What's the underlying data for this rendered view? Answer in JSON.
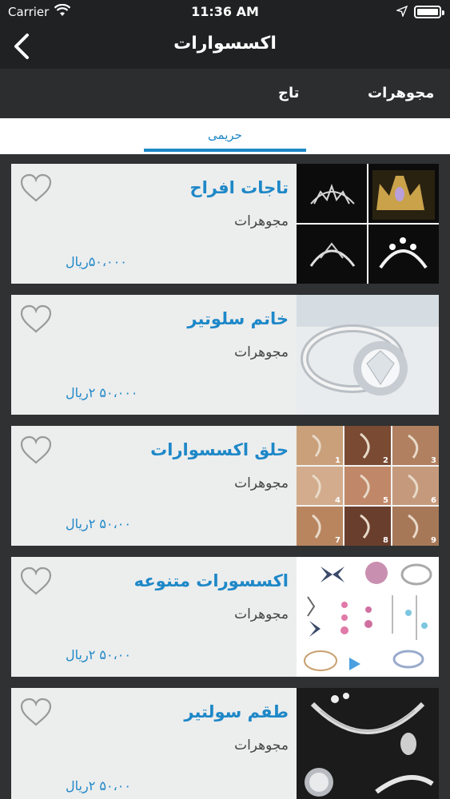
{
  "status": {
    "carrier": "Carrier",
    "time": "11:36 AM"
  },
  "nav": {
    "title": "اکسسوارات"
  },
  "categories": [
    "مجوهرات",
    "تاج"
  ],
  "subtab": {
    "label": "حریمی"
  },
  "colors": {
    "accent": "#1e88c8",
    "nav_bg": "#1f2122",
    "card_bg": "#eceded"
  },
  "products": [
    {
      "name": "تاجات افراح",
      "category": "مجوهرات",
      "price": "۵۰،۰۰۰ریال",
      "image": "tiaras"
    },
    {
      "name": "خاتم سلوتیر",
      "category": "مجوهرات",
      "price": "۵۰،۰۰۰ ۲ریال",
      "image": "solitaire-ring"
    },
    {
      "name": "حلق اکسسوارات",
      "category": "مجوهرات",
      "price": "۵۰،۰۰ ۲ریال",
      "image": "ear-cuffs"
    },
    {
      "name": "اکسسورات متنوعه",
      "category": "مجوهرات",
      "price": "۵۰،۰۰ ۲ریال",
      "image": "assorted-jewelry"
    },
    {
      "name": "طقم سولتیر",
      "category": "مجوهرات",
      "price": "۵۰،۰۰ ۲ریال",
      "image": "jewelry-set"
    }
  ]
}
